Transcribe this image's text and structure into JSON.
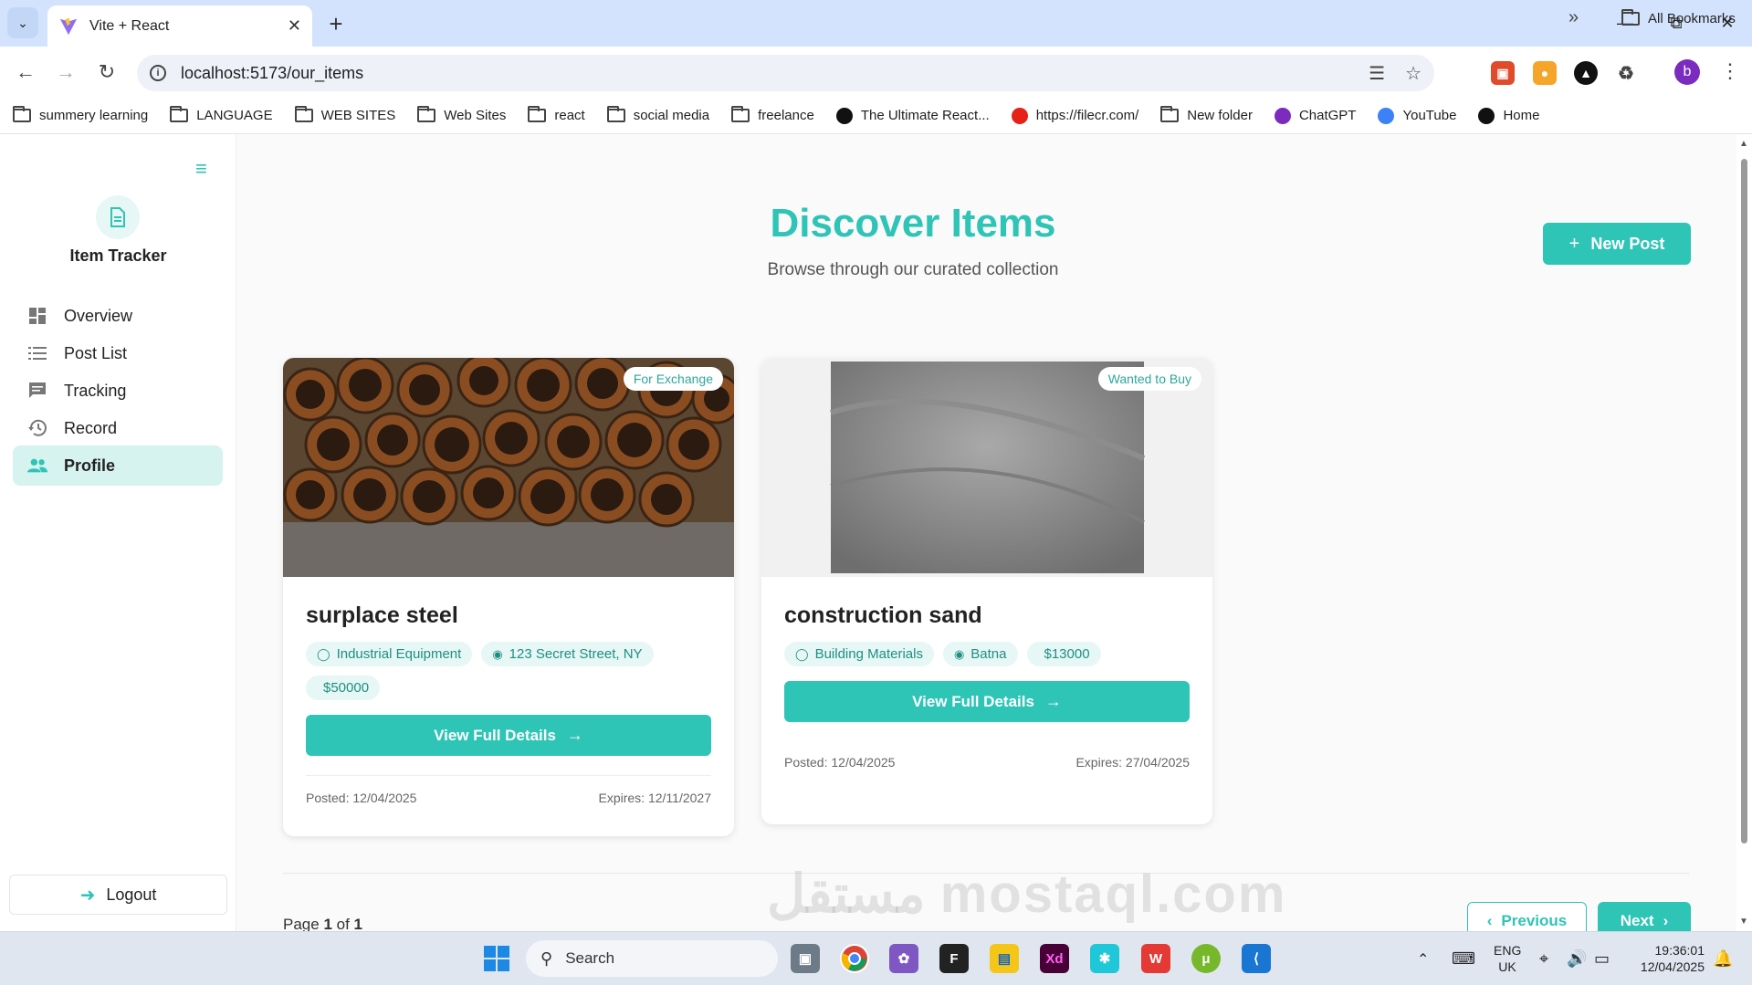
{
  "browser": {
    "tab_title": "Vite + React",
    "url": "localhost:5173/our_items",
    "profile_initial": "b",
    "bookmarks": [
      {
        "label": "summery learning",
        "type": "folder"
      },
      {
        "label": "LANGUAGE",
        "type": "folder"
      },
      {
        "label": "WEB SITES",
        "type": "folder"
      },
      {
        "label": "Web Sites",
        "type": "folder"
      },
      {
        "label": "react",
        "type": "folder"
      },
      {
        "label": "social media",
        "type": "folder"
      },
      {
        "label": "freelance",
        "type": "folder"
      },
      {
        "label": "The Ultimate React...",
        "type": "site"
      },
      {
        "label": "https://filecr.com/",
        "type": "site"
      },
      {
        "label": "New folder",
        "type": "folder"
      },
      {
        "label": "ChatGPT",
        "type": "site"
      },
      {
        "label": "YouTube",
        "type": "site"
      },
      {
        "label": "Home",
        "type": "site"
      }
    ],
    "all_bookmarks": "All Bookmarks"
  },
  "sidebar": {
    "brand": "Item Tracker",
    "items": [
      {
        "label": "Overview",
        "icon": "dashboard-icon"
      },
      {
        "label": "Post List",
        "icon": "list-icon"
      },
      {
        "label": "Tracking",
        "icon": "chat-icon"
      },
      {
        "label": "Record",
        "icon": "history-icon"
      },
      {
        "label": "Profile",
        "icon": "people-icon",
        "active": true
      }
    ],
    "logout": "Logout"
  },
  "main": {
    "title": "Discover Items",
    "subtitle": "Browse through our curated collection",
    "new_post": "New Post",
    "cards": [
      {
        "badge": "For Exchange",
        "title": "surplace steel",
        "category": "Industrial Equipment",
        "location": "123 Secret Street, NY",
        "price": "$50000",
        "button": "View Full Details",
        "posted": "Posted: 12/04/2025",
        "expires": "Expires: 12/11/2027"
      },
      {
        "badge": "Wanted to Buy",
        "title": "construction sand",
        "category": "Building Materials",
        "location": "Batna",
        "price": "$13000",
        "button": "View Full Details",
        "posted": "Posted: 12/04/2025",
        "expires": "Expires: 27/04/2025"
      }
    ],
    "pagination": {
      "prefix": "Page ",
      "current": "1",
      "of": " of ",
      "total": "1",
      "previous": "Previous",
      "next": "Next"
    }
  },
  "taskbar": {
    "search": "Search",
    "lang_line1": "ENG",
    "lang_line2": "UK",
    "time": "19:36:01",
    "date": "12/04/2025"
  },
  "watermark": "مستقل mostaql.com",
  "colors": {
    "accent": "#2ec4b6",
    "accent_light": "#e6f7f5",
    "tab_strip": "#d3e3fd"
  }
}
